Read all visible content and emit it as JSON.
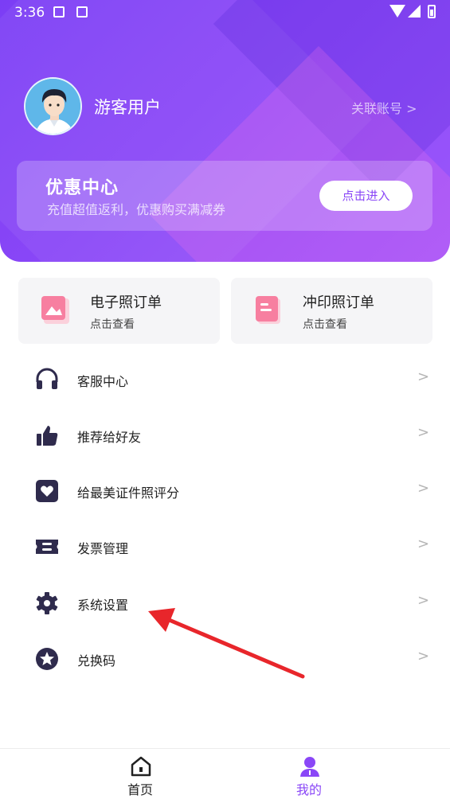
{
  "status_bar": {
    "time": "3:36"
  },
  "profile": {
    "username": "游客用户",
    "link_account": "关联账号 >"
  },
  "promo": {
    "title": "优惠中心",
    "subtitle": "充值超值返利，优惠购买满减券",
    "button": "点击进入"
  },
  "order_cards": [
    {
      "title": "电子照订单",
      "subtitle": "点击查看",
      "icon": "photo-icon"
    },
    {
      "title": "冲印照订单",
      "subtitle": "点击查看",
      "icon": "document-icon"
    }
  ],
  "menu": [
    {
      "label": "客服中心",
      "icon": "headset-icon"
    },
    {
      "label": "推荐给好友",
      "icon": "thumbs-up-icon"
    },
    {
      "label": "给最美证件照评分",
      "icon": "heart-icon"
    },
    {
      "label": "发票管理",
      "icon": "ticket-icon"
    },
    {
      "label": "系统设置",
      "icon": "gear-icon"
    },
    {
      "label": "兑换码",
      "icon": "star-icon"
    }
  ],
  "chevron": ">",
  "tabbar": [
    {
      "label": "首页",
      "icon": "home-icon",
      "active": false
    },
    {
      "label": "我的",
      "icon": "person-icon",
      "active": true
    }
  ],
  "colors": {
    "accent": "#8a47f7",
    "icon_dark": "#2f2b4d",
    "annotation": "#e8262b",
    "pink": "#f77fa0"
  }
}
